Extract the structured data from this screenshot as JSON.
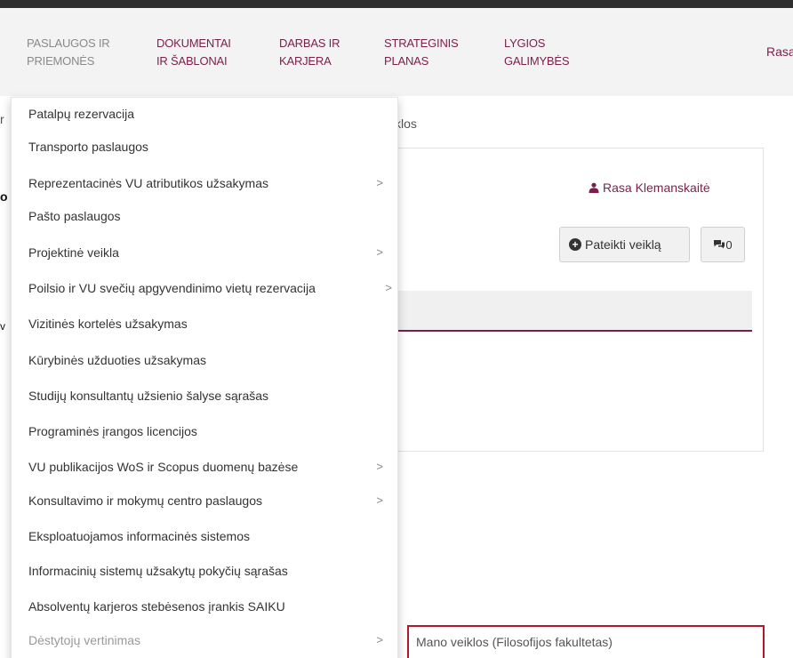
{
  "nav": {
    "items": [
      {
        "line1": "PASLAUGOS IR",
        "line2": "PRIEMONĖS"
      },
      {
        "line1": "DOKUMENTAI",
        "line2": "IR ŠABLONAI"
      },
      {
        "line1": "DARBAS IR",
        "line2": "KARJERA"
      },
      {
        "line1": "STRATEGINIS",
        "line2": "PLANAS"
      },
      {
        "line1": "LYGIOS",
        "line2": "GALIMYBĖS"
      }
    ],
    "user_cut": "Rasa"
  },
  "page": {
    "breadcrumb_tail": "klos",
    "left_clip_1": "r",
    "left_clip_2": "o",
    "left_clip_3": "v",
    "user_name": "Rasa Klemanskaitė",
    "submit_label": "Pateikti veiklą",
    "comments_label": "0"
  },
  "menu": {
    "items": [
      {
        "label": "Patalpų rezervacija",
        "has_sub": ""
      },
      {
        "label": "Transporto paslaugos",
        "has_sub": ""
      },
      {
        "label": "Reprezentacinės VU atributikos užsakymas",
        "has_sub": ">"
      },
      {
        "label": "Pašto paslaugos",
        "has_sub": ""
      },
      {
        "label": "Projektinė veikla",
        "has_sub": ">"
      },
      {
        "label": "Poilsio ir VU svečių apgyvendinimo vietų rezervacija",
        "has_sub": ">"
      },
      {
        "label": "Vizitinės kortelės užsakymas",
        "has_sub": ""
      },
      {
        "label": "Kūrybinės užduoties užsakymas",
        "has_sub": ""
      },
      {
        "label": "Studijų konsultantų užsienio šalyse sąrašas",
        "has_sub": ""
      },
      {
        "label": "Programinės įrangos licencijos",
        "has_sub": ""
      },
      {
        "label": "VU publikacijos WoS ir Scopus duomenų bazėse",
        "has_sub": ">"
      },
      {
        "label": "Konsultavimo ir mokymų centro paslaugos",
        "has_sub": ">"
      },
      {
        "label": "Eksploatuojamos informacinės sistemos",
        "has_sub": ""
      },
      {
        "label": "Informacinių sistemų užsakytų pokyčių sąrašas",
        "has_sub": ""
      },
      {
        "label": "Absolventų karjeros stebėsenos įrankis SAIKU",
        "has_sub": ""
      },
      {
        "label": "Dėstytojų vertinimas",
        "has_sub": ">"
      }
    ]
  },
  "submenu": {
    "item": "Mano veiklos (Filosofijos fakultetas)"
  },
  "colors": {
    "brand": "#7a1f4a",
    "highlight_border": "#b5172a",
    "nav_bg": "#f3f3f3"
  }
}
